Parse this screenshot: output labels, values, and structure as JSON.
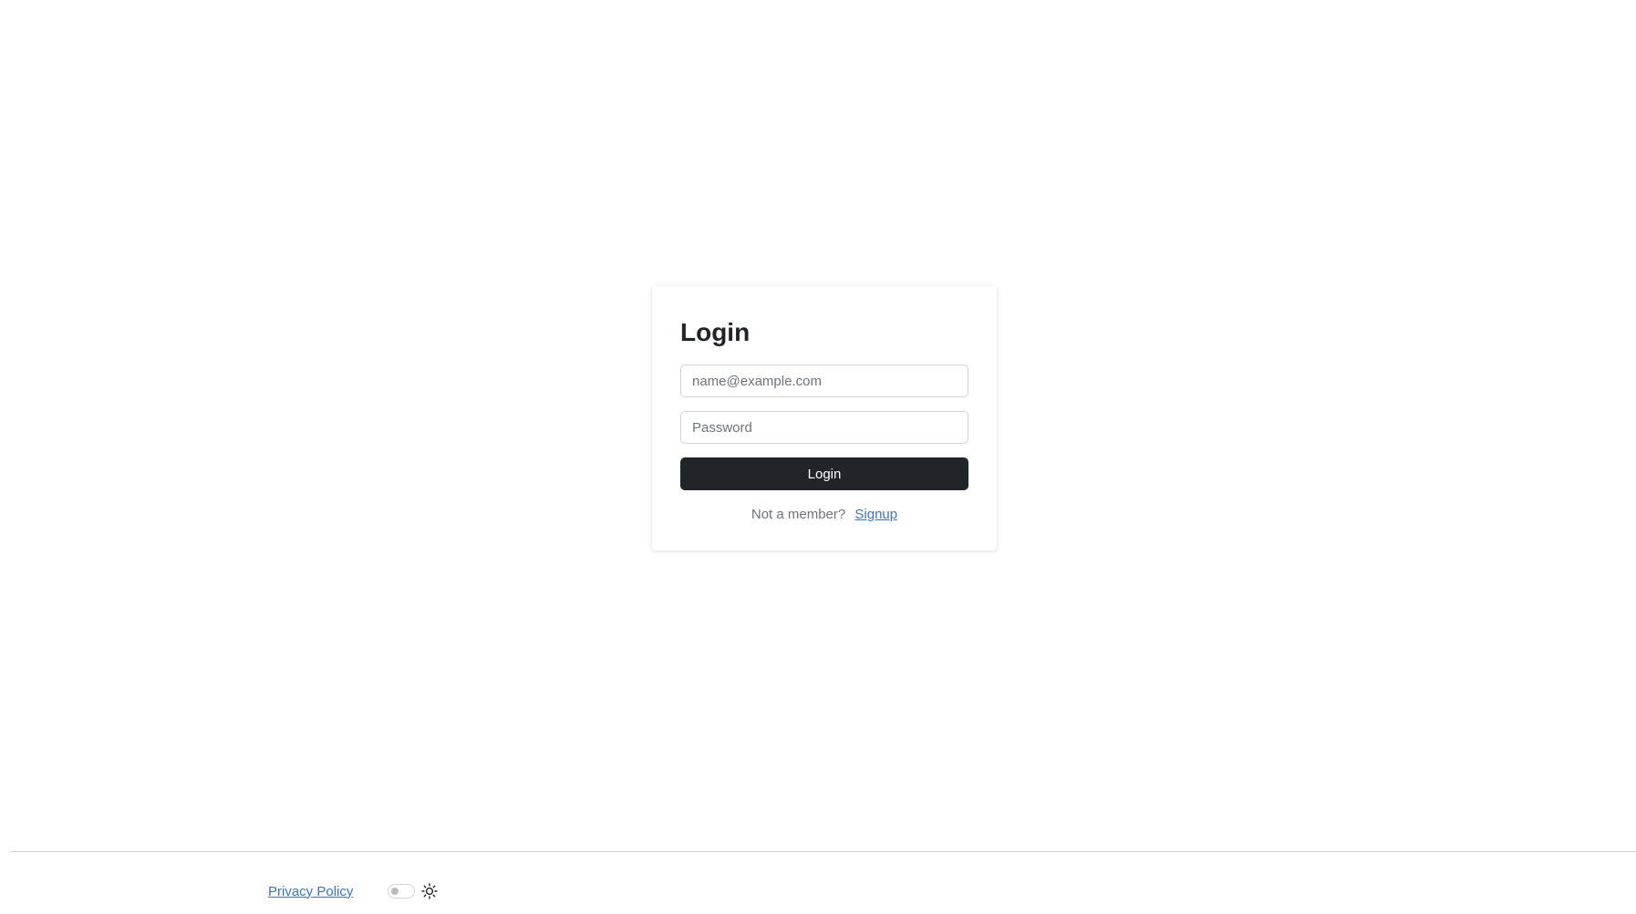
{
  "login_card": {
    "title": "Login",
    "email_placeholder": "name@example.com",
    "email_value": "",
    "password_placeholder": "Password",
    "password_value": "",
    "submit_label": "Login",
    "signup_prompt": "Not a member?",
    "signup_link": "Signup"
  },
  "footer": {
    "privacy_link": "Privacy Policy",
    "theme_toggle_on": false,
    "theme_icon": "sun-icon"
  },
  "colors": {
    "primary_button": "#212529",
    "link": "#3b74c6"
  }
}
